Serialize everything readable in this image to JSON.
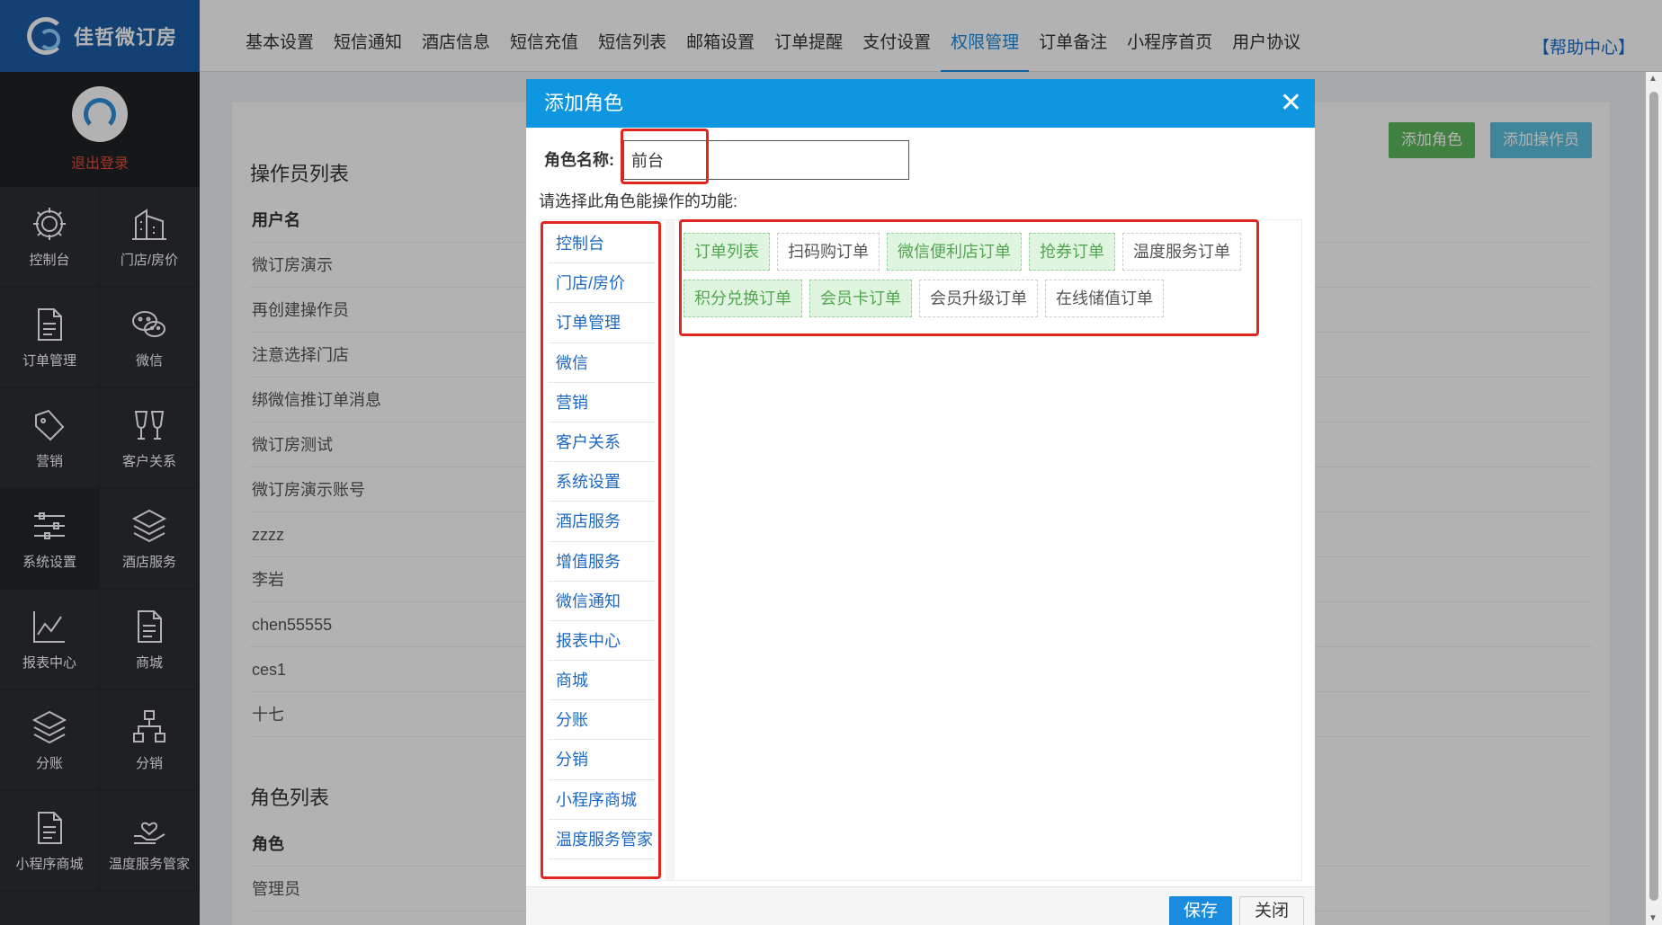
{
  "brand": {
    "name": "佳哲微订房"
  },
  "profile": {
    "logout": "退出登录"
  },
  "sidebar": {
    "items": [
      {
        "label": "控制台",
        "icon": "gear-icon"
      },
      {
        "label": "门店/房价",
        "icon": "building-icon"
      },
      {
        "label": "订单管理",
        "icon": "document-icon"
      },
      {
        "label": "微信",
        "icon": "wechat-icon"
      },
      {
        "label": "营销",
        "icon": "tag-icon"
      },
      {
        "label": "客户关系",
        "icon": "glasses-icon"
      },
      {
        "label": "系统设置",
        "icon": "sliders-icon"
      },
      {
        "label": "酒店服务",
        "icon": "layers-icon"
      },
      {
        "label": "报表中心",
        "icon": "chart-icon"
      },
      {
        "label": "商城",
        "icon": "document-icon"
      },
      {
        "label": "分账",
        "icon": "layers-icon"
      },
      {
        "label": "分销",
        "icon": "hierarchy-icon"
      },
      {
        "label": "小程序商城",
        "icon": "document-icon"
      },
      {
        "label": "温度服务管家",
        "icon": "hand-heart-icon"
      }
    ]
  },
  "topnav": {
    "items": [
      "基本设置",
      "短信通知",
      "酒店信息",
      "短信充值",
      "短信列表",
      "邮箱设置",
      "订单提醒",
      "支付设置",
      "权限管理",
      "订单备注",
      "小程序首页",
      "用户协议"
    ],
    "active_index": 8,
    "help": "【帮助中心】"
  },
  "content": {
    "add_role": "添加角色",
    "add_operator": "添加操作员",
    "operators_title": "操作员列表",
    "operators_header": "用户名",
    "operators": [
      "微订房演示",
      "再创建操作员",
      "注意选择门店",
      "绑微信推订单消息",
      "微订房测试",
      "微订房演示账号",
      "zzzz",
      "李岩",
      "chen55555",
      "ces1",
      "十七"
    ],
    "roles_title": "角色列表",
    "roles_header": "角色",
    "roles": [
      "管理员"
    ]
  },
  "dialog": {
    "title": "添加角色",
    "name_label": "角色名称:",
    "name_value": "前台",
    "hint": "请选择此角色能操作的功能:",
    "categories": [
      "控制台",
      "门店/房价",
      "订单管理",
      "微信",
      "营销",
      "客户关系",
      "系统设置",
      "酒店服务",
      "增值服务",
      "微信通知",
      "报表中心",
      "商城",
      "分账",
      "分销",
      "小程序商城",
      "温度服务管家"
    ],
    "permissions": [
      {
        "label": "订单列表",
        "selected": true
      },
      {
        "label": "扫码购订单",
        "selected": false
      },
      {
        "label": "微信便利店订单",
        "selected": true
      },
      {
        "label": "抢券订单",
        "selected": true
      },
      {
        "label": "温度服务订单",
        "selected": false
      },
      {
        "label": "积分兑换订单",
        "selected": true
      },
      {
        "label": "会员卡订单",
        "selected": true
      },
      {
        "label": "会员升级订单",
        "selected": false
      },
      {
        "label": "在线储值订单",
        "selected": false
      }
    ],
    "save": "保存",
    "close": "关闭"
  },
  "colors": {
    "accent": "#1a8ce0",
    "sidebar": "#2b2f33",
    "selected_bg": "#dff5df",
    "annotation": "#e0261e"
  }
}
